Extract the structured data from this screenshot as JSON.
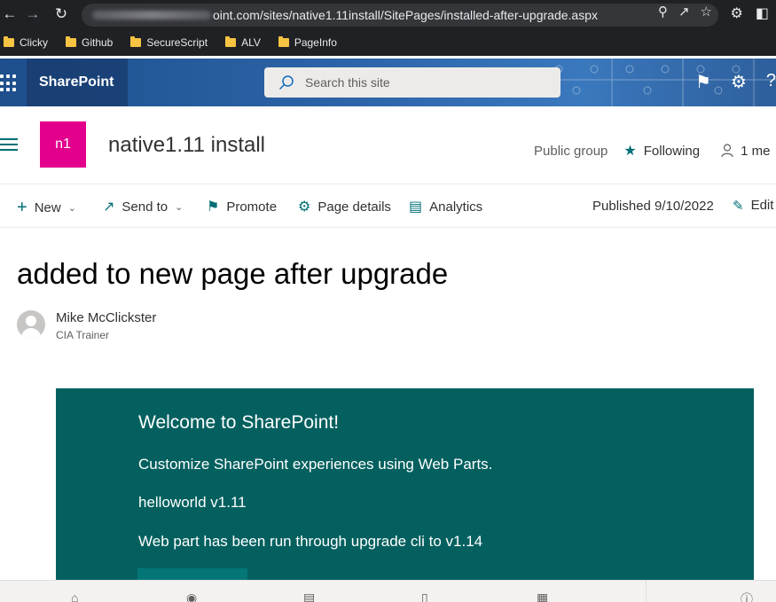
{
  "browser": {
    "url_visible": "oint.com/sites/native1.11install/SitePages/installed-after-upgrade.aspx",
    "bookmarks": [
      "Clicky",
      "Github",
      "SecureScript",
      "ALV",
      "PageInfo"
    ]
  },
  "suite_bar": {
    "brand": "SharePoint",
    "search_placeholder": "Search this site"
  },
  "site_header": {
    "logo_text": "n1",
    "title": "native1.11 install",
    "privacy": "Public group",
    "following_label": "Following",
    "members_label": "1 me"
  },
  "command_bar": {
    "new_label": "New",
    "send_to_label": "Send to",
    "promote_label": "Promote",
    "page_details_label": "Page details",
    "analytics_label": "Analytics",
    "published_label": "Published 9/10/2022",
    "edit_label": "Edit"
  },
  "page": {
    "title": "added to new page after upgrade",
    "author_name": "Mike McClickster",
    "author_role": "CIA Trainer"
  },
  "webpart": {
    "title": "Welcome to SharePoint!",
    "lines": [
      "Customize SharePoint experiences using Web Parts.",
      "helloworld v1.11",
      "Web part has been run through upgrade cli to v1.14"
    ],
    "bg_color": "#03605f"
  },
  "colors": {
    "accent": "#006e75",
    "site_logo": "#e3008c",
    "suite_bar": "#2d64a8"
  }
}
